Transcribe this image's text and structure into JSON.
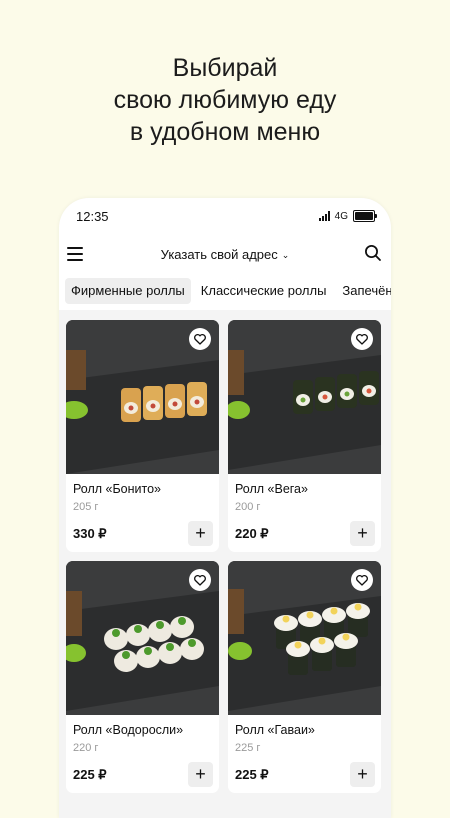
{
  "promo": {
    "line1": "Выбирай",
    "line2": "свою любимую еду",
    "line3": "в удобном меню"
  },
  "status_bar": {
    "time": "12:35",
    "network": "4G"
  },
  "header": {
    "address_label": "Указать свой адрес"
  },
  "tabs": [
    {
      "label": "Фирменные роллы",
      "active": true
    },
    {
      "label": "Классические роллы",
      "active": false
    },
    {
      "label": "Запечённые роллы",
      "active": false
    }
  ],
  "products": [
    {
      "name": "Ролл «Бонито»",
      "weight": "205 г",
      "price": "330 ₽"
    },
    {
      "name": "Ролл «Вега»",
      "weight": "200 г",
      "price": "220 ₽"
    },
    {
      "name": "Ролл «Водоросли»",
      "weight": "220 г",
      "price": "225 ₽"
    },
    {
      "name": "Ролл «Гаваи»",
      "weight": "225 г",
      "price": "225 ₽"
    }
  ],
  "colors": {
    "background": "#fcfbe9",
    "card": "#ffffff",
    "slate": "#3a3b3c",
    "wasabi": "#7fbf2a"
  }
}
